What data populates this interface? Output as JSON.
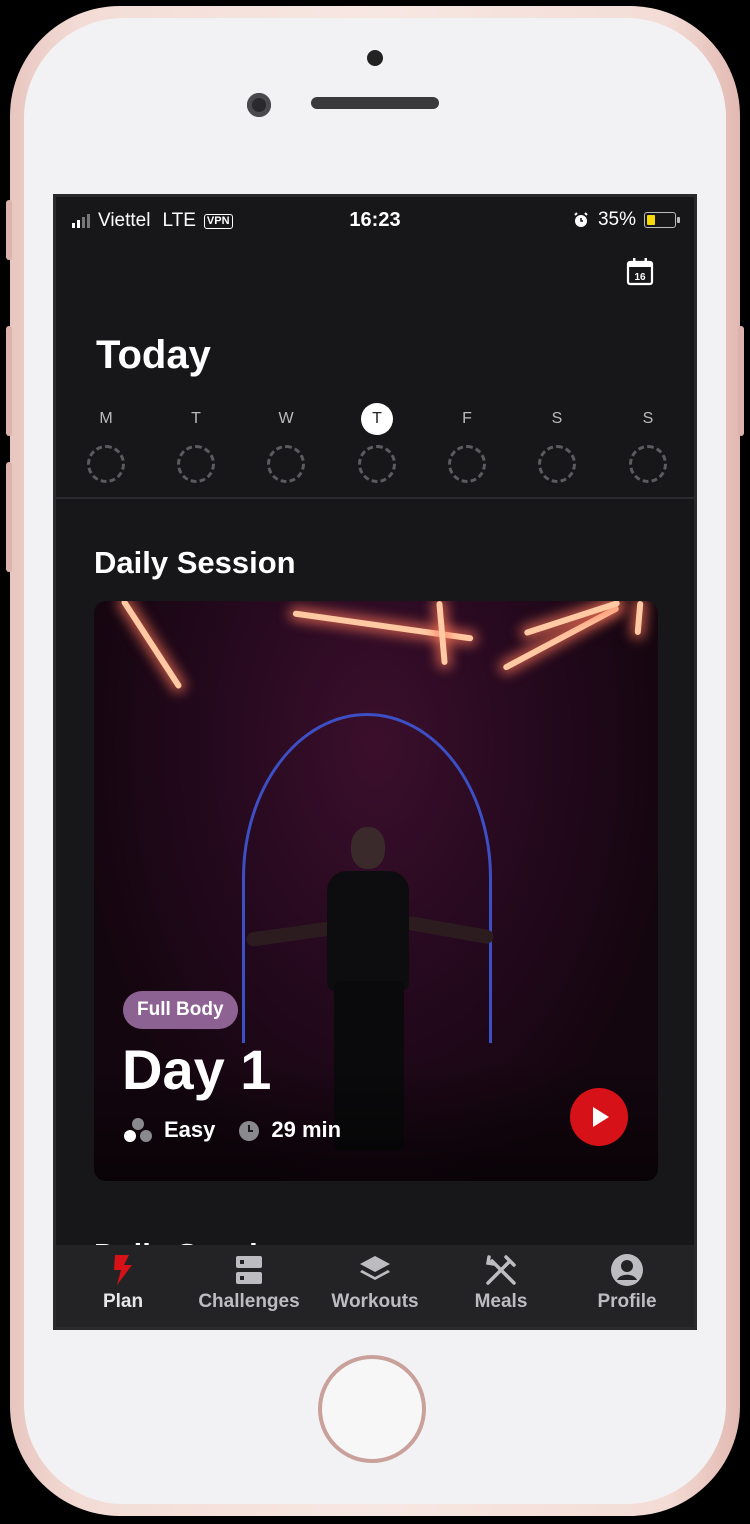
{
  "status_bar": {
    "carrier": "Viettel",
    "network": "LTE",
    "vpn": "VPN",
    "time": "16:23",
    "battery": "35%"
  },
  "header": {
    "calendar_day": "16",
    "title": "Today"
  },
  "week": {
    "days": [
      "M",
      "T",
      "W",
      "T",
      "F",
      "S",
      "S"
    ],
    "active_index": 3
  },
  "daily_session": {
    "section_title": "Daily Session",
    "tag": "Full Body",
    "title": "Day 1",
    "difficulty": "Easy",
    "duration": "29 min"
  },
  "next_section_peek": "Daily Sessi",
  "tabbar": {
    "items": [
      {
        "label": "Plan",
        "icon": "bolt-icon"
      },
      {
        "label": "Challenges",
        "icon": "challenges-icon"
      },
      {
        "label": "Workouts",
        "icon": "layers-icon"
      },
      {
        "label": "Meals",
        "icon": "utensils-icon"
      },
      {
        "label": "Profile",
        "icon": "user-icon"
      }
    ],
    "active_index": 0
  },
  "colors": {
    "accent": "#d61218",
    "background": "#17171a",
    "tabbar": "#232326",
    "tag": "#b482be"
  }
}
